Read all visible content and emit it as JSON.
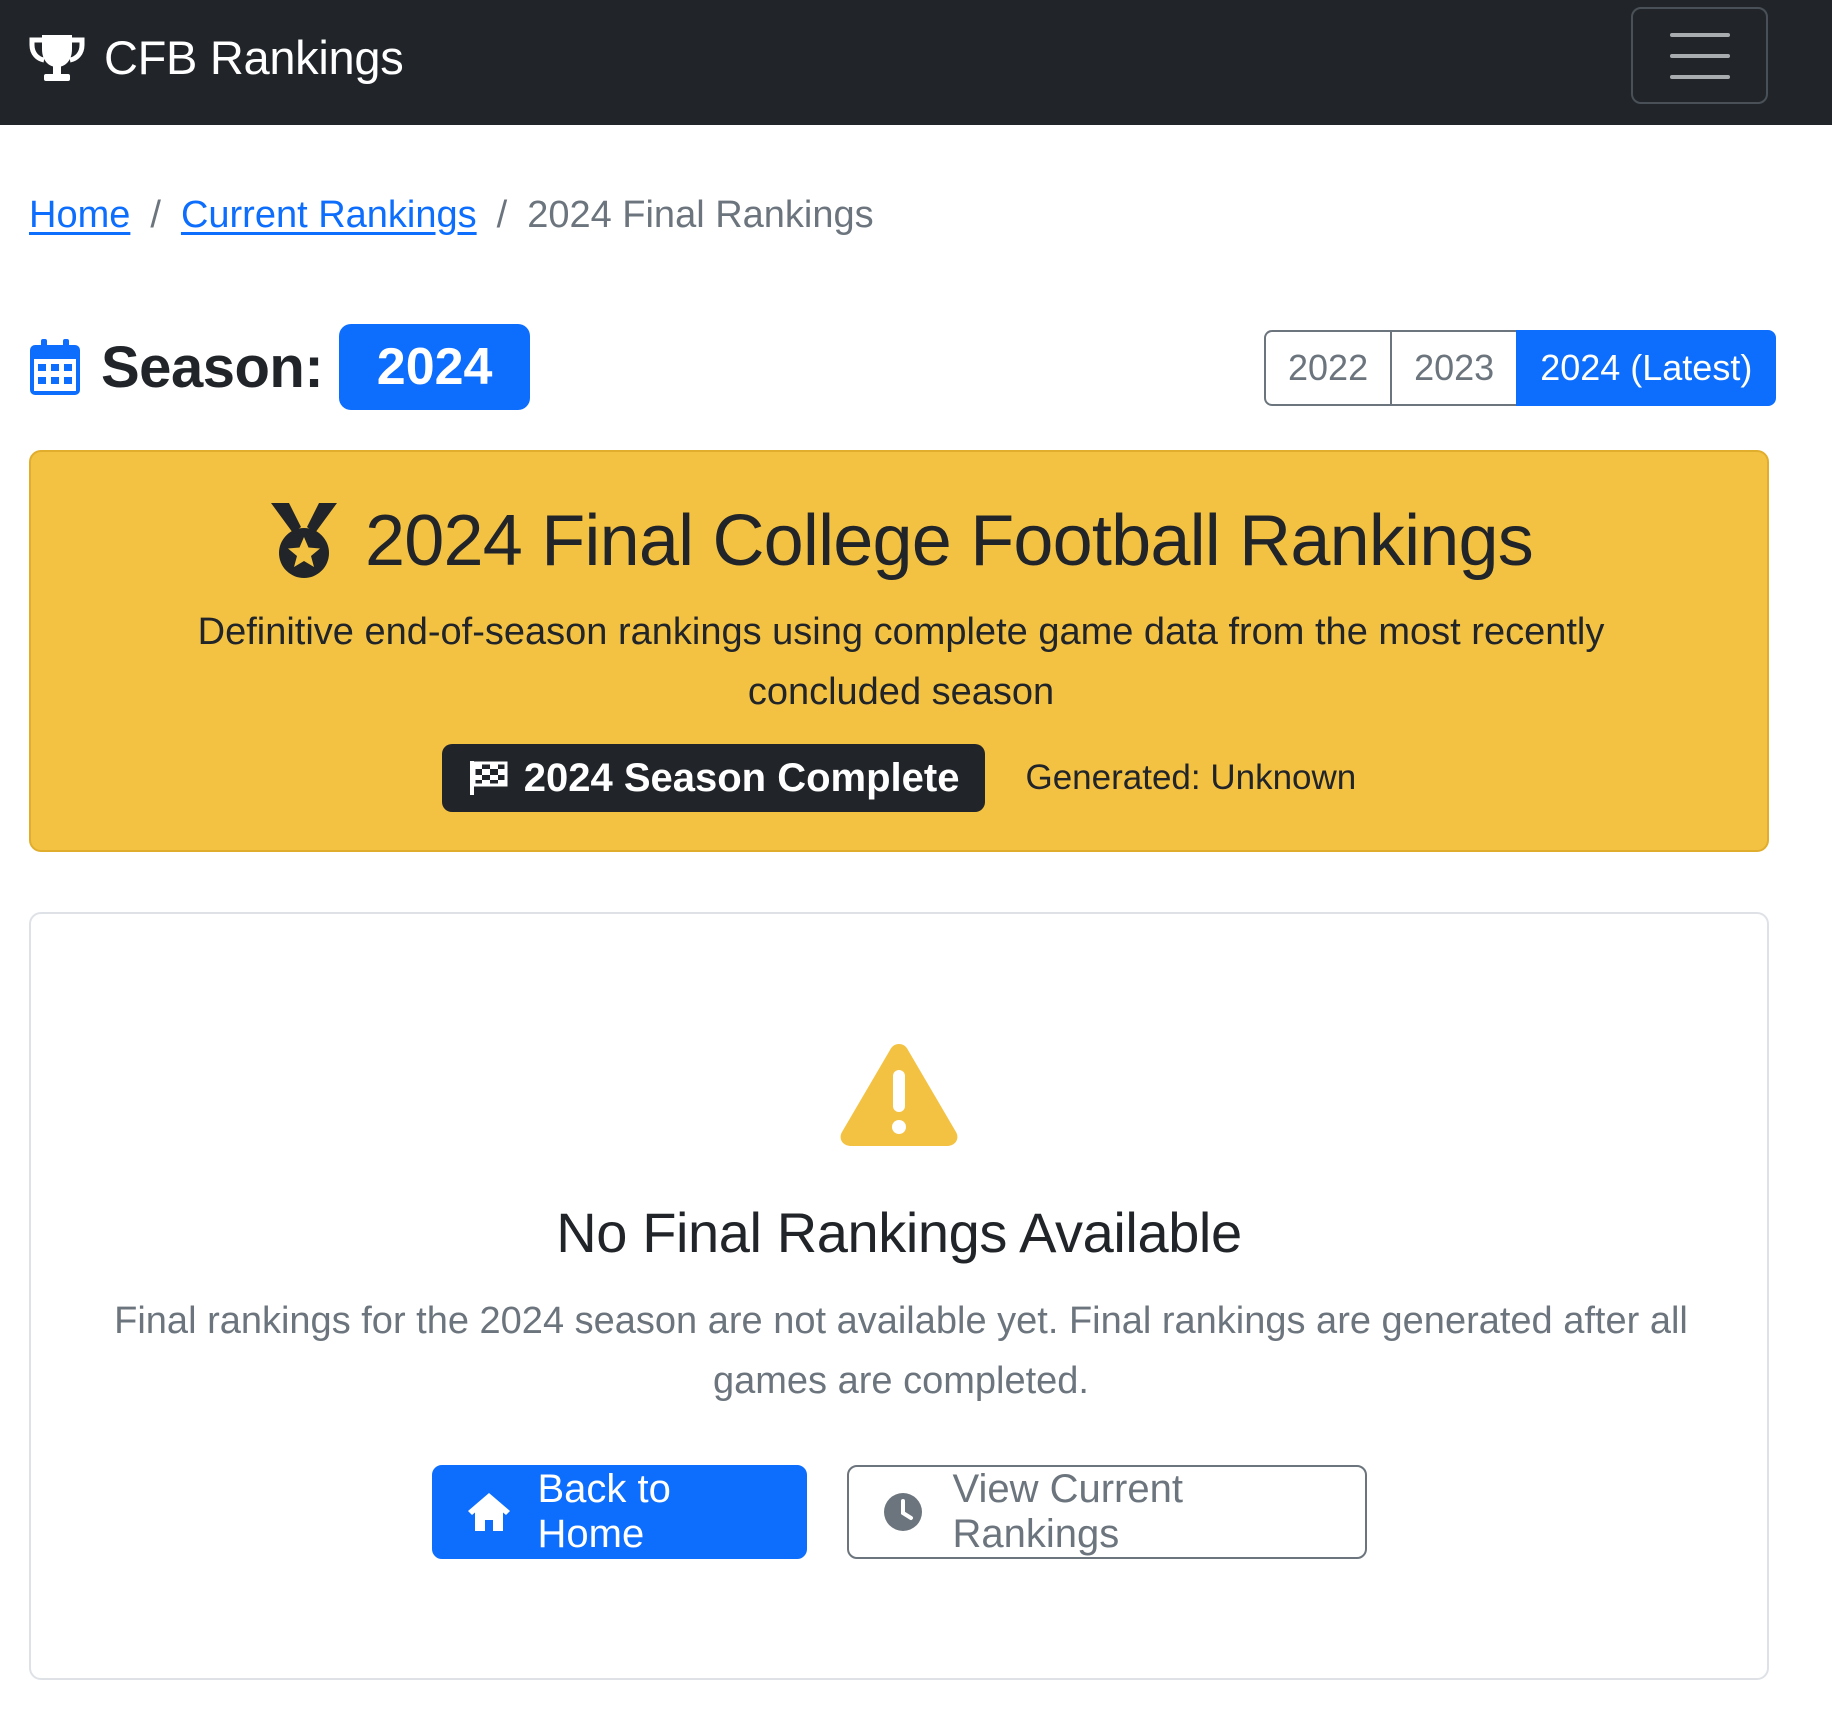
{
  "navbar": {
    "brand": "CFB Rankings",
    "brand_icon": "trophy-icon",
    "toggler_icon": "hamburger-menu-icon"
  },
  "breadcrumb": {
    "items": [
      {
        "label": "Home"
      },
      {
        "label": "Current Rankings"
      }
    ],
    "separator": "/",
    "active": "2024 Final Rankings"
  },
  "season": {
    "label": "Season:",
    "value": "2024",
    "icon": "calendar-icon",
    "years": [
      {
        "label": "2022",
        "active": false
      },
      {
        "label": "2023",
        "active": false
      },
      {
        "label": "2024 (Latest)",
        "active": true
      }
    ]
  },
  "hero": {
    "icon": "medal-icon",
    "title": "2024 Final College Football Rankings",
    "subtitle": "Definitive end-of-season rankings using complete game data from the most recently concluded season",
    "badge": "2024 Season Complete",
    "badge_icon": "checkered-flag-icon",
    "generated": "Generated: Unknown",
    "background": "#f4c243"
  },
  "empty_state": {
    "icon": "warning-triangle-icon",
    "title": "No Final Rankings Available",
    "message": "Final rankings for the 2024 season are not available yet. Final rankings are generated after all games are completed.",
    "primary_button": "Back to Home",
    "primary_icon": "home-icon",
    "secondary_button": "View Current Rankings",
    "secondary_icon": "clock-icon"
  },
  "colors": {
    "navbar": "#212529",
    "primary": "#0d6efd",
    "warning": "#f4c243",
    "muted": "#6c757d"
  }
}
